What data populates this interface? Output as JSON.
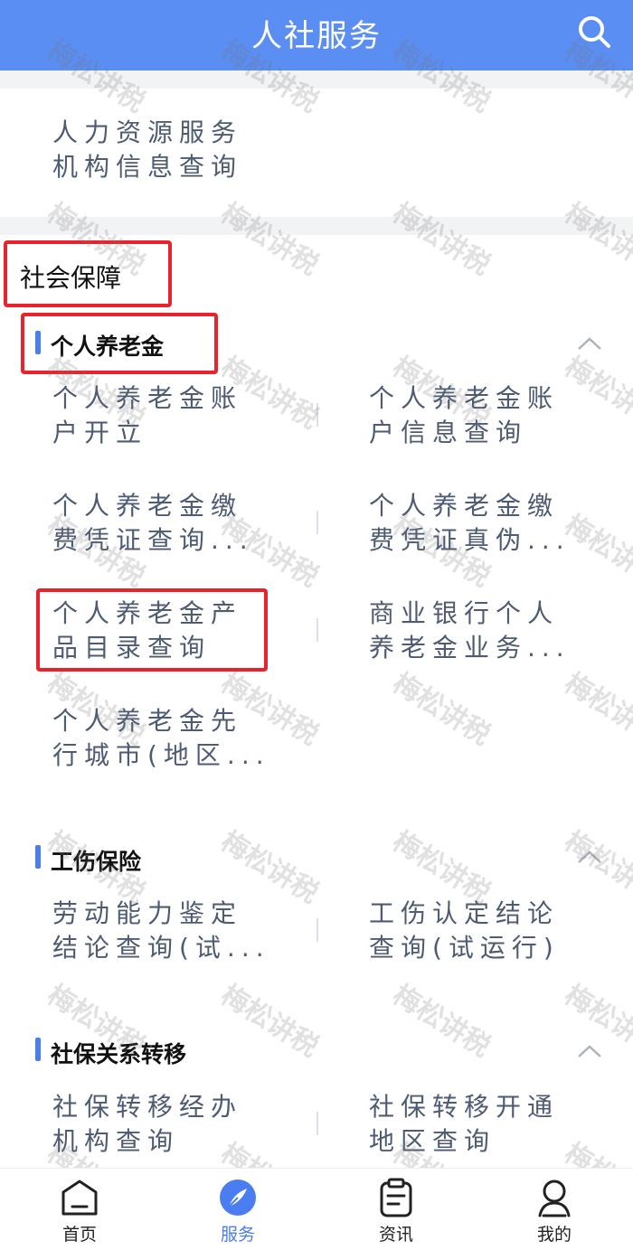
{
  "header": {
    "title": "人社服务",
    "search_icon": "search-icon"
  },
  "hr_service": {
    "link": "人力资源服务\n机构信息查询"
  },
  "social_security": {
    "title": "社会保障",
    "groups": [
      {
        "title": "个人养老金",
        "items": [
          "个人养老金账\n户开立",
          "个人养老金账\n户信息查询",
          "个人养老金缴\n费凭证查询...",
          "个人养老金缴\n费凭证真伪...",
          "个人养老金产\n品目录查询",
          "商业银行个人\n养老金业务...",
          "个人养老金先\n行城市(地区..."
        ]
      },
      {
        "title": "工伤保险",
        "items": [
          "劳动能力鉴定\n结论查询(试...",
          "工伤认定结论\n查询(试运行)"
        ]
      },
      {
        "title": "社保关系转移",
        "items": [
          "社保转移经办\n机构查询",
          "社保转移开通\n地区查询"
        ]
      }
    ]
  },
  "watermark": "梅松讲税",
  "tabbar": {
    "tabs": [
      {
        "label": "首页",
        "icon": "home-icon"
      },
      {
        "label": "服务",
        "icon": "compass-icon",
        "active": true
      },
      {
        "label": "资讯",
        "icon": "clipboard-icon"
      },
      {
        "label": "我的",
        "icon": "profile-icon"
      }
    ]
  },
  "colors": {
    "header_bg": "#5b8ef2",
    "accent": "#4a7df0",
    "highlight_box": "#e8232b"
  }
}
